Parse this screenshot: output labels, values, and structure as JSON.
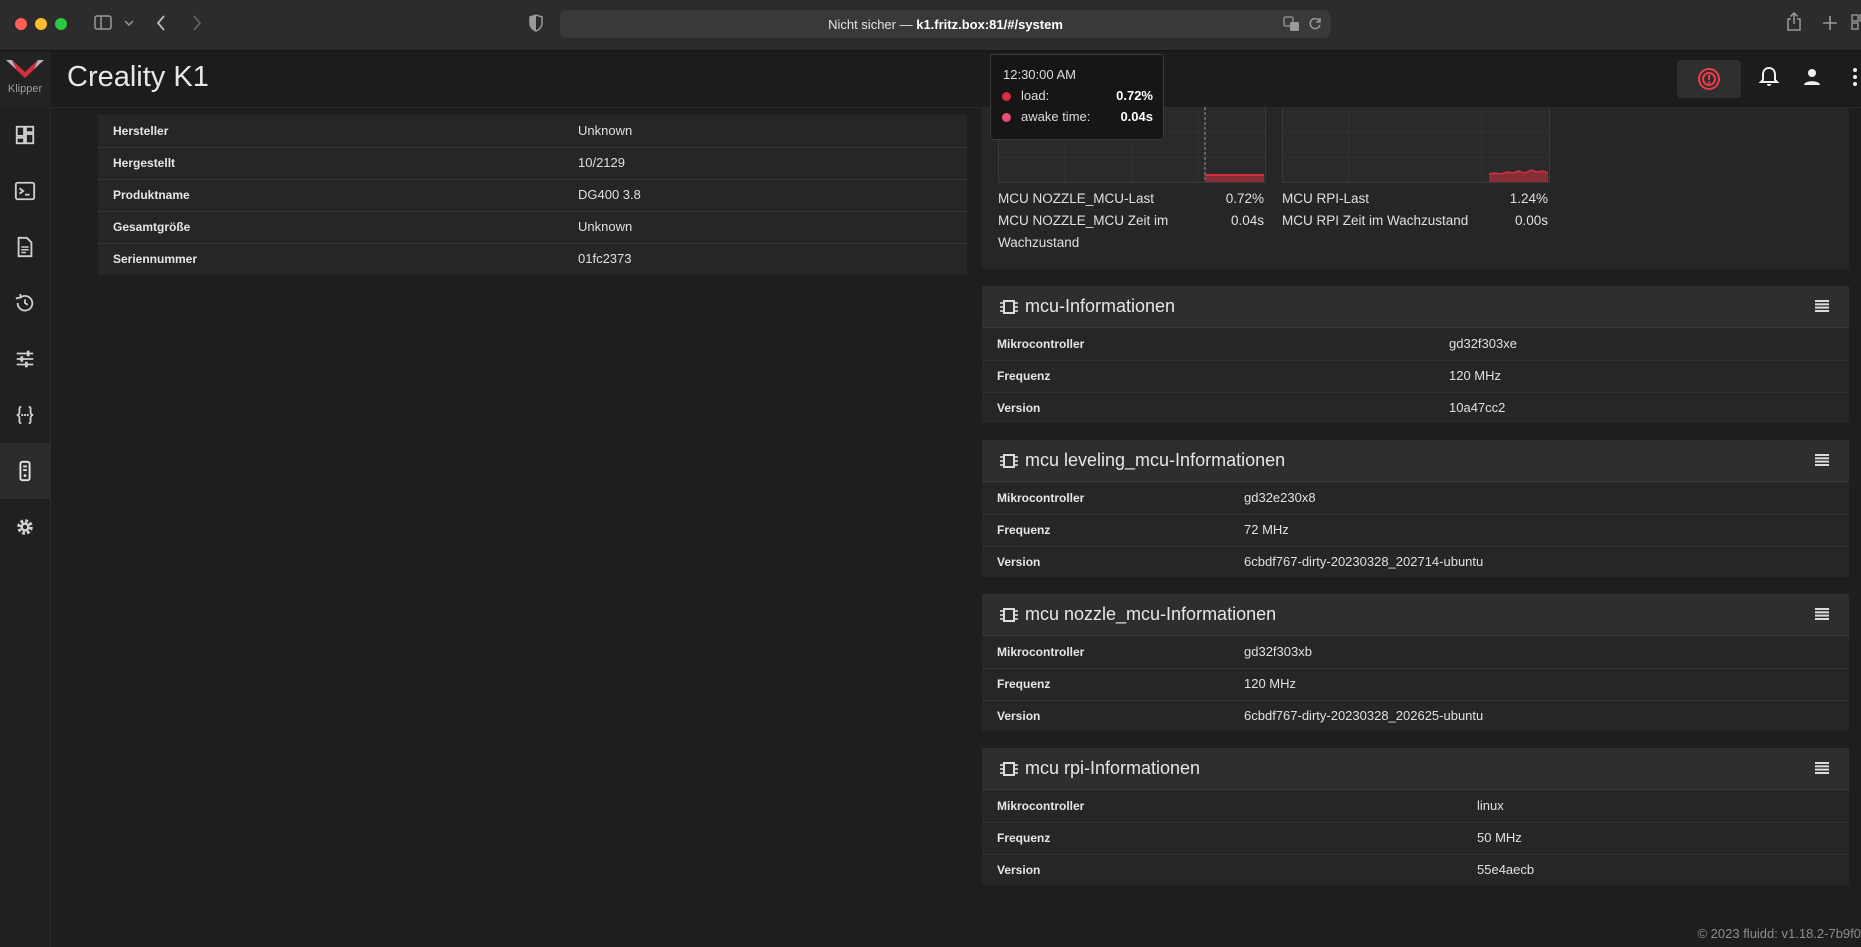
{
  "browser": {
    "address_prefix": "Nicht sicher — ",
    "address_host": "k1.fritz.box:81/#/system"
  },
  "app": {
    "logo_text": "Klipper",
    "title": "Creality K1"
  },
  "sidebar": {
    "items": [
      {
        "icon": "dashboard-icon"
      },
      {
        "icon": "console-icon"
      },
      {
        "icon": "file-icon"
      },
      {
        "icon": "history-icon"
      },
      {
        "icon": "tune-icon"
      },
      {
        "icon": "code-braces-icon"
      },
      {
        "icon": "system-icon",
        "active": true
      },
      {
        "icon": "gear-icon"
      }
    ]
  },
  "sd_info": {
    "rows": [
      {
        "label": "Hersteller",
        "value": "Unknown"
      },
      {
        "label": "Hergestellt",
        "value": "10/2129"
      },
      {
        "label": "Produktname",
        "value": "DG400 3.8"
      },
      {
        "label": "Gesamtgröße",
        "value": "Unknown"
      },
      {
        "label": "Seriennummer",
        "value": "01fc2373"
      }
    ]
  },
  "tooltip": {
    "time": "12:30:00 AM",
    "load_label": "load:",
    "load_value": "0.72%",
    "awake_label": "awake time:",
    "awake_value": "0.04s",
    "load_color": "#d32f3f",
    "awake_color": "#e94e77"
  },
  "mcu_load": {
    "nozzle": {
      "load_label": "MCU NOZZLE_MCU-Last",
      "load_value": "0.72%",
      "awake_label_1": "MCU NOZZLE_MCU Zeit im",
      "awake_label_2": "Wachzustand",
      "awake_value": "0.04s"
    },
    "rpi": {
      "load_label": "MCU RPI-Last",
      "load_value": "1.24%",
      "awake_label": "MCU RPI Zeit im Wachzustand",
      "awake_value": "0.00s"
    }
  },
  "mcu_cards": [
    {
      "title": "mcu-Informationen",
      "rows": [
        {
          "label": "Mikrocontroller",
          "value": "gd32f303xe"
        },
        {
          "label": "Frequenz",
          "value": "120 MHz"
        },
        {
          "label": "Version",
          "value": "10a47cc2"
        }
      ]
    },
    {
      "title": "mcu leveling_mcu-Informationen",
      "rows": [
        {
          "label": "Mikrocontroller",
          "value": "gd32e230x8"
        },
        {
          "label": "Frequenz",
          "value": "72 MHz"
        },
        {
          "label": "Version",
          "value": "6cbdf767-dirty-20230328_202714-ubuntu"
        }
      ]
    },
    {
      "title": "mcu nozzle_mcu-Informationen",
      "rows": [
        {
          "label": "Mikrocontroller",
          "value": "gd32f303xb"
        },
        {
          "label": "Frequenz",
          "value": "120 MHz"
        },
        {
          "label": "Version",
          "value": "6cbdf767-dirty-20230328_202625-ubuntu"
        }
      ]
    },
    {
      "title": "mcu rpi-Informationen",
      "rows": [
        {
          "label": "Mikrocontroller",
          "value": "linux"
        },
        {
          "label": "Frequenz",
          "value": "50 MHz"
        },
        {
          "label": "Version",
          "value": "55e4aecb"
        }
      ]
    }
  ],
  "footer": "© 2023 fluidd: v1.18.2-7b9f0",
  "colors": {
    "accent_red": "#d32f3f",
    "estop_red": "#ef3b4a"
  }
}
